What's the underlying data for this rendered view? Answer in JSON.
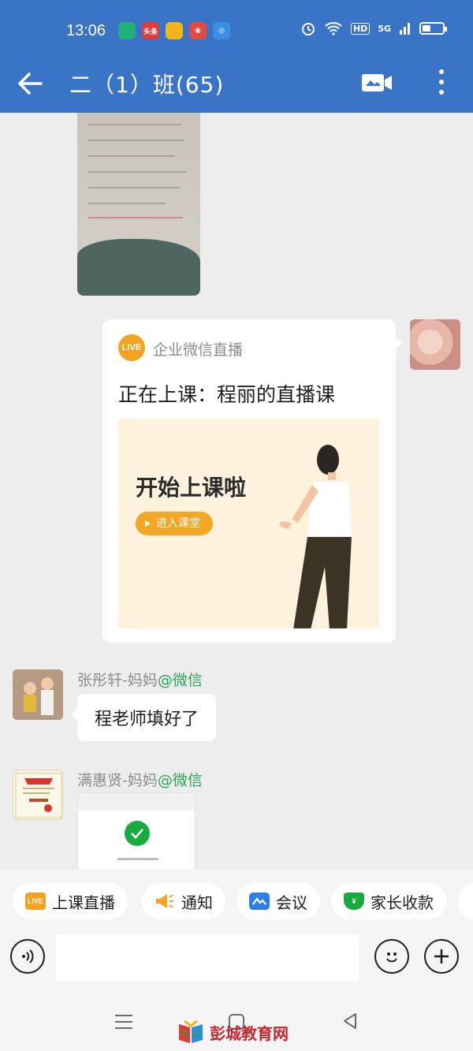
{
  "status_bar": {
    "time": "13:06",
    "app_icons": [
      {
        "name": "green-app-icon",
        "label": "",
        "color": "#21b07a"
      },
      {
        "name": "toutiao-icon",
        "label": "头条",
        "color": "#e33b3b"
      },
      {
        "name": "yellow-app-icon",
        "label": "",
        "color": "#f2b51d"
      },
      {
        "name": "weibo-icon",
        "label": "",
        "color": "#e4493f"
      },
      {
        "name": "blue-app-icon",
        "label": "",
        "color": "#3a8fe3"
      }
    ],
    "hd_label": "HD",
    "network_label": "5G"
  },
  "header": {
    "title": "二（1）班(65)"
  },
  "messages": {
    "live_card": {
      "badge": "LIVE",
      "source": "企业微信直播",
      "title": "正在上课：程丽的直播课",
      "banner_heading": "开始上课啦",
      "enter_label": "进入课堂"
    },
    "zhang": {
      "sender_name": "张彤轩-妈妈",
      "sender_tag": "@微信",
      "text": "程老师填好了"
    },
    "man": {
      "sender_name": "满惠贤-妈妈",
      "sender_tag": "@微信"
    }
  },
  "quick_actions": [
    {
      "label": "上课直播",
      "icon": "live-icon",
      "icon_text": "LIVE",
      "color": "#f2a321"
    },
    {
      "label": "通知",
      "icon": "megaphone-icon",
      "icon_text": "",
      "color": "#f2a321"
    },
    {
      "label": "会议",
      "icon": "meeting-icon",
      "icon_text": "",
      "color": "#2f7fe6"
    },
    {
      "label": "家长收款",
      "icon": "payment-icon",
      "icon_text": "¥",
      "color": "#1aab3e"
    }
  ],
  "input": {
    "placeholder": ""
  },
  "watermark": {
    "text": "彭城教育网"
  },
  "colors": {
    "header_bg": "#3a74c7",
    "accent_orange": "#f4a724",
    "wechat_green": "#2aa557"
  }
}
